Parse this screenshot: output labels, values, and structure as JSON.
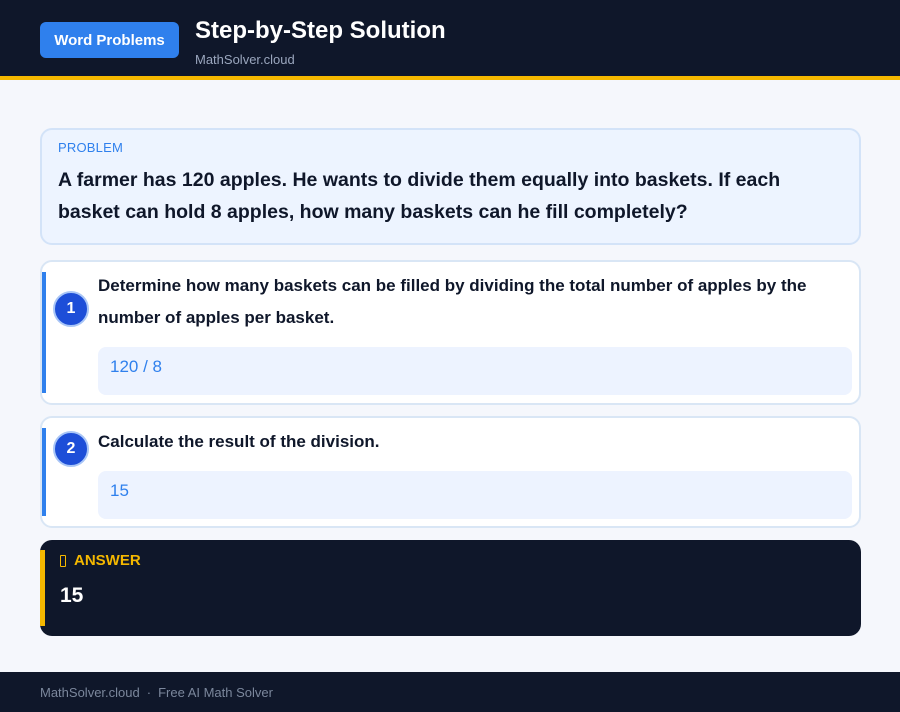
{
  "header": {
    "badge": "Word Problems",
    "title": "Step-by-Step Solution",
    "subtitle": "MathSolver.cloud"
  },
  "problem": {
    "label": "PROBLEM",
    "text": "A farmer has 120 apples. He wants to divide them equally into baskets. If each basket can hold 8 apples, how many baskets can he fill completely?"
  },
  "steps": [
    {
      "number": "1",
      "text": "Determine how many baskets can be filled by dividing the total number of apples by the number of apples per basket.",
      "calc": "120 / 8"
    },
    {
      "number": "2",
      "text": "Calculate the result of the division.",
      "calc": "15"
    }
  ],
  "answer": {
    "icon": "lightbulb-icon",
    "label": "ANSWER",
    "value": "15"
  },
  "footer": {
    "site": "MathSolver.cloud",
    "separator": "·",
    "tagline": "Free AI Math Solver"
  },
  "colors": {
    "dark": "#0f172a",
    "accent_blue": "#2f80ed",
    "accent_gold": "#f5b800"
  }
}
